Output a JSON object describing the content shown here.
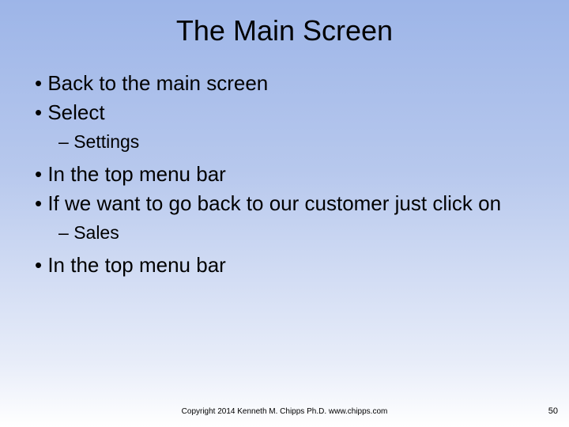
{
  "title": "The Main Screen",
  "bullets": {
    "b1": "Back to the main screen",
    "b2": "Select",
    "b2s1": "Settings",
    "b3": "In the top menu bar",
    "b4": "If we want to go back to our customer just click on",
    "b4s1": "Sales",
    "b5": "In the top menu bar"
  },
  "footer": {
    "copyright": "Copyright 2014 Kenneth M. Chipps Ph.D. www.chipps.com",
    "page": "50"
  }
}
